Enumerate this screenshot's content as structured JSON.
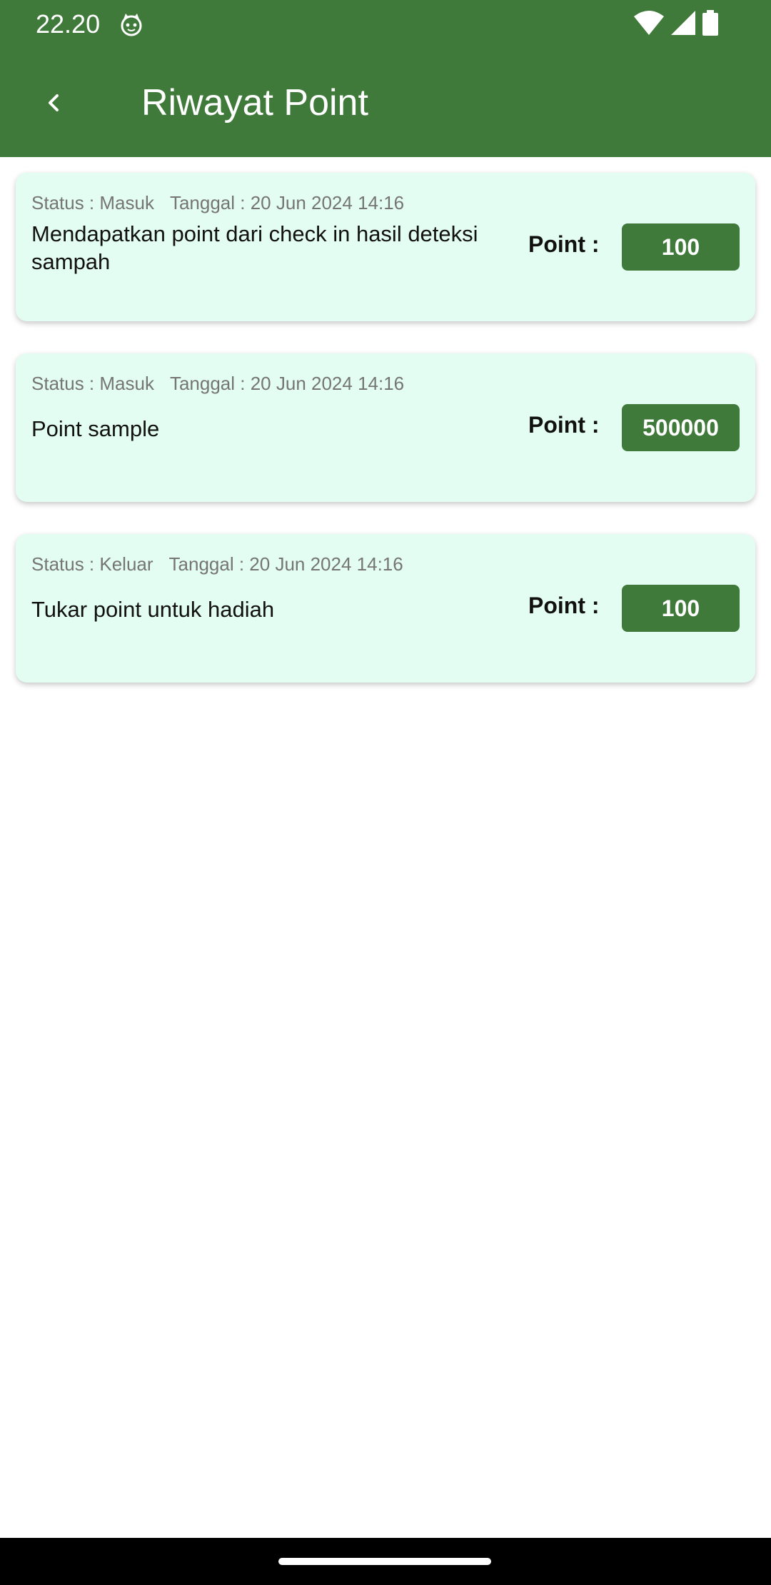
{
  "status_bar": {
    "time": "22.20",
    "icons": [
      "cat-icon",
      "wifi-icon",
      "cell-signal-icon",
      "battery-icon"
    ]
  },
  "header": {
    "title": "Riwayat Point",
    "back_icon": "back-arrow-icon",
    "background_color": "#3f7a3a"
  },
  "cards": [
    {
      "status": "Status : Masuk",
      "date": "Tanggal : 20 Jun 2024 14:16",
      "description": "Mendapatkan point dari check in hasil deteksi sampah",
      "point_label": "Point :",
      "point_value": "100"
    },
    {
      "status": "Status : Masuk",
      "date": "Tanggal : 20 Jun 2024 14:16",
      "description": "Point sample",
      "point_label": "Point :",
      "point_value": "500000"
    },
    {
      "status": "Status : Keluar",
      "date": "Tanggal : 20 Jun 2024 14:16",
      "description": "Tukar point untuk hadiah",
      "point_label": "Point :",
      "point_value": "100"
    }
  ],
  "colors": {
    "accent": "#3f7a3a",
    "card_background": "#e3fdf2"
  }
}
